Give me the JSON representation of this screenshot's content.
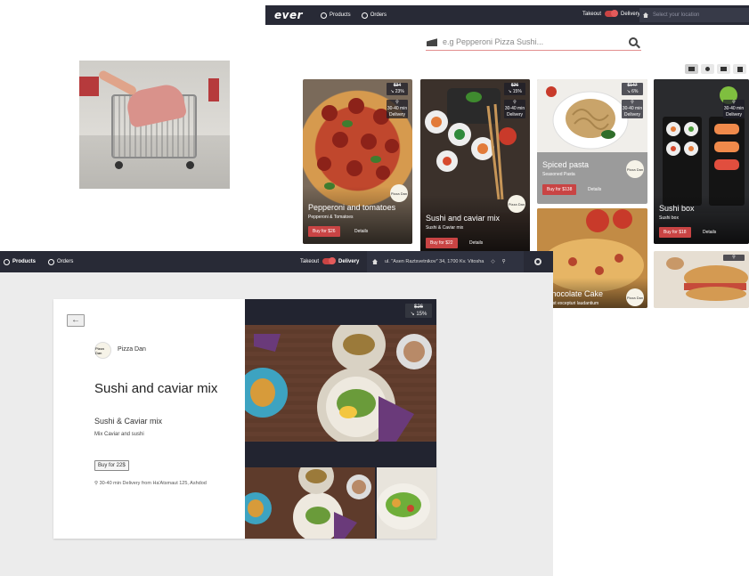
{
  "colors": {
    "navbar": "#282a36",
    "accent": "#c94444",
    "page_bg": "#ececec"
  },
  "top_app": {
    "logo": "ever",
    "nav": [
      {
        "label": "Products",
        "icon": "food-icon"
      },
      {
        "label": "Orders",
        "icon": "history-icon"
      }
    ],
    "takeout_label": "Takeout",
    "delivery_label": "Delivery",
    "location_placeholder": "Select your location",
    "search_placeholder": "e.g Pepperoni Pizza Sushi...",
    "products": [
      {
        "name": "Pepperoni and tomatoes",
        "subtitle": "Pepperoni & Tomatoes",
        "buy": "Buy for $26",
        "details": "Details",
        "old_price": "$34",
        "discount": "23%",
        "delivery": "30-40 min Delivery",
        "store": "Pizza Dan"
      },
      {
        "name": "Sushi and caviar mix",
        "subtitle": "Sushi & Caviar mix",
        "buy": "Buy for $22",
        "details": "Details",
        "old_price": "$26",
        "discount": "15%",
        "delivery": "30-40 min Delivery",
        "store": "Pizza Dan"
      },
      {
        "name": "Spiced pasta",
        "subtitle": "Seasoned Pasta",
        "buy": "Buy for $138",
        "details": "Details",
        "old_price": "$147",
        "discount": "6%",
        "delivery": "30-40 min Delivery",
        "store": "Pizza Dan"
      },
      {
        "name": "Sushi box",
        "subtitle": "Sushi box",
        "buy": "Buy for $18",
        "details": "Details",
        "old_price": "",
        "discount": "",
        "delivery": "30-40 min Delivery",
        "store": ""
      },
      {
        "name": "te Chocolate Cake",
        "subtitle": "ut sed est excepturi laudantium",
        "store": "Pizza Dan"
      }
    ]
  },
  "bottom_app": {
    "nav": [
      {
        "label": "Products",
        "icon": "food-icon"
      },
      {
        "label": "Orders",
        "icon": "history-icon"
      }
    ],
    "takeout_label": "Takeout",
    "delivery_label": "Delivery",
    "address": "ul. \"Asen Raztsvetnikov\" 34, 1700 Kv. Vitosha",
    "detail": {
      "back_icon": "arrow-left-icon",
      "store_logo_text": "Pizza Dan",
      "store_name": "Pizza Dan",
      "title": "Sushi and caviar mix",
      "subtitle": "Sushi & Caviar mix",
      "description": "Mix Caviar and sushi",
      "buy_label": "Buy for 22$",
      "delivery_text": "30-40 min Delivery from Ha'Atsmaut 125, Ashdod",
      "old_price": "$26",
      "discount": "15%"
    }
  }
}
